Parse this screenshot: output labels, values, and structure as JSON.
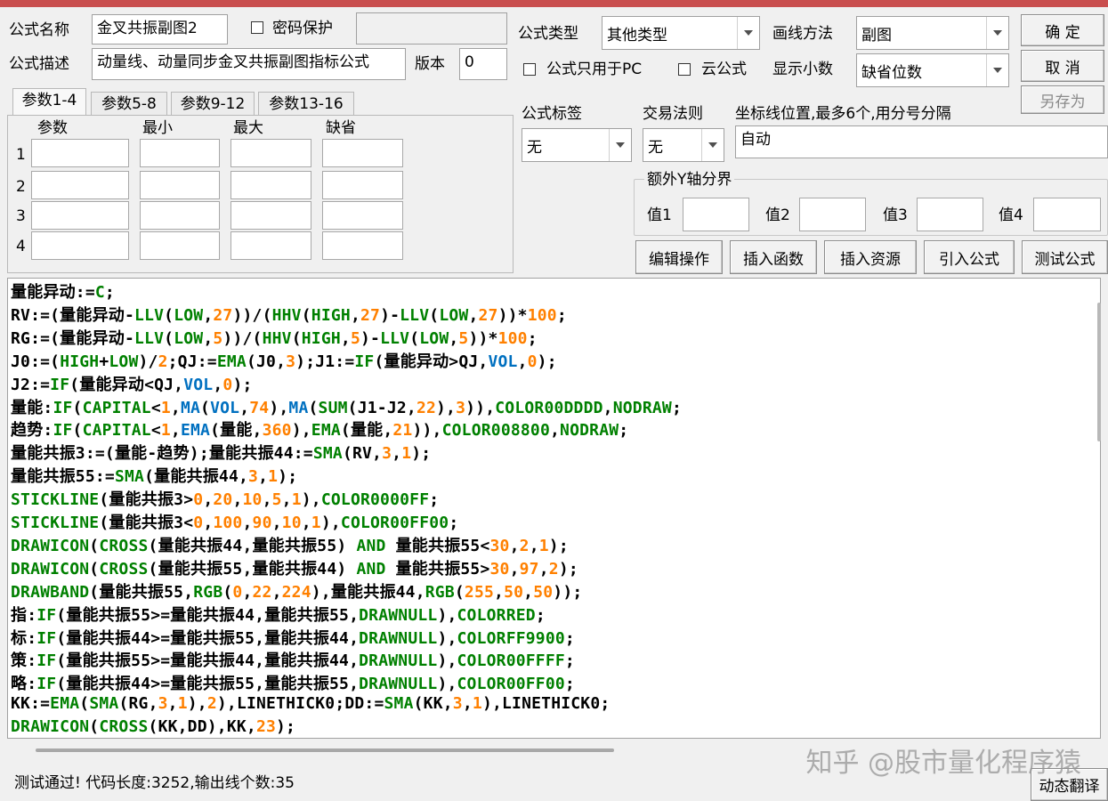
{
  "header": {
    "name_label": "公式名称",
    "name_value": "金叉共振副图2",
    "password_label": "密码保护",
    "password_value": "",
    "desc_label": "公式描述",
    "desc_value": "动量线、动量同步金叉共振副图指标公式",
    "version_label": "版本",
    "version_value": "0",
    "type_label": "公式类型",
    "type_value": "其他类型",
    "draw_label": "画线方法",
    "draw_value": "副图",
    "pc_only_label": "公式只用于PC",
    "cloud_label": "云公式",
    "decimals_label": "显示小数",
    "decimals_value": "缺省位数"
  },
  "buttons": {
    "ok": "确 定",
    "cancel": "取 消",
    "save_as": "另存为",
    "edit_ops": "编辑操作",
    "insert_func": "插入函数",
    "insert_res": "插入资源",
    "import_formula": "引入公式",
    "test_formula": "测试公式",
    "dynamic_translate": "动态翻译"
  },
  "tabs": [
    "参数1-4",
    "参数5-8",
    "参数9-12",
    "参数13-16"
  ],
  "params": {
    "headers": [
      "参数",
      "最小",
      "最大",
      "缺省"
    ],
    "rows": [
      "1",
      "2",
      "3",
      "4"
    ]
  },
  "options": {
    "tag_label": "公式标签",
    "tag_value": "无",
    "trade_label": "交易法则",
    "trade_value": "无",
    "axis_label": "坐标线位置,最多6个,用分号分隔",
    "axis_value": "自动",
    "extra_y_label": "额外Y轴分界",
    "v1": "值1",
    "v2": "值2",
    "v3": "值3",
    "v4": "值4"
  },
  "colors": {
    "keyword": "#008000",
    "number": "#ff8000",
    "series": "#0070c0",
    "plain": "#000000"
  },
  "code_lines": [
    [
      [
        "量能异动:=",
        0
      ],
      [
        "C",
        1
      ],
      [
        ";",
        0
      ]
    ],
    [
      [
        "RV:=(量能异动-",
        0
      ],
      [
        "LLV",
        1
      ],
      [
        "(",
        0
      ],
      [
        "LOW",
        1
      ],
      [
        ",",
        0
      ],
      [
        "27",
        2
      ],
      [
        "))/(",
        0
      ],
      [
        "HHV",
        1
      ],
      [
        "(",
        0
      ],
      [
        "HIGH",
        1
      ],
      [
        ",",
        0
      ],
      [
        "27",
        2
      ],
      [
        ")-",
        0
      ],
      [
        "LLV",
        1
      ],
      [
        "(",
        0
      ],
      [
        "LOW",
        1
      ],
      [
        ",",
        0
      ],
      [
        "27",
        2
      ],
      [
        "))*",
        0
      ],
      [
        "100",
        2
      ],
      [
        ";",
        0
      ]
    ],
    [
      [
        "RG:=(量能异动-",
        0
      ],
      [
        "LLV",
        1
      ],
      [
        "(",
        0
      ],
      [
        "LOW",
        1
      ],
      [
        ",",
        0
      ],
      [
        "5",
        2
      ],
      [
        "))/(",
        0
      ],
      [
        "HHV",
        1
      ],
      [
        "(",
        0
      ],
      [
        "HIGH",
        1
      ],
      [
        ",",
        0
      ],
      [
        "5",
        2
      ],
      [
        ")-",
        0
      ],
      [
        "LLV",
        1
      ],
      [
        "(",
        0
      ],
      [
        "LOW",
        1
      ],
      [
        ",",
        0
      ],
      [
        "5",
        2
      ],
      [
        "))*",
        0
      ],
      [
        "100",
        2
      ],
      [
        ";",
        0
      ]
    ],
    [
      [
        "J0:=(",
        0
      ],
      [
        "HIGH",
        1
      ],
      [
        "+",
        0
      ],
      [
        "LOW",
        1
      ],
      [
        ")/",
        0
      ],
      [
        "2",
        2
      ],
      [
        ";QJ:=",
        0
      ],
      [
        "EMA",
        1
      ],
      [
        "(J0,",
        0
      ],
      [
        "3",
        2
      ],
      [
        ");J1:=",
        0
      ],
      [
        "IF",
        1
      ],
      [
        "(量能异动>QJ,",
        0
      ],
      [
        "VOL",
        3
      ],
      [
        ",",
        0
      ],
      [
        "0",
        2
      ],
      [
        ");",
        0
      ]
    ],
    [
      [
        "J2:=",
        0
      ],
      [
        "IF",
        1
      ],
      [
        "(量能异动<QJ,",
        0
      ],
      [
        "VOL",
        3
      ],
      [
        ",",
        0
      ],
      [
        "0",
        2
      ],
      [
        ");",
        0
      ]
    ],
    [
      [
        "量能:",
        0
      ],
      [
        "IF",
        1
      ],
      [
        "(",
        0
      ],
      [
        "CAPITAL",
        1
      ],
      [
        "<",
        0
      ],
      [
        "1",
        2
      ],
      [
        ",",
        0
      ],
      [
        "MA",
        3
      ],
      [
        "(",
        0
      ],
      [
        "VOL",
        3
      ],
      [
        ",",
        0
      ],
      [
        "74",
        2
      ],
      [
        "),",
        0
      ],
      [
        "MA",
        3
      ],
      [
        "(",
        0
      ],
      [
        "SUM",
        1
      ],
      [
        "(J1-J2,",
        0
      ],
      [
        "22",
        2
      ],
      [
        "),",
        0
      ],
      [
        "3",
        2
      ],
      [
        ")),",
        0
      ],
      [
        "COLOR00DDDD",
        1
      ],
      [
        ",",
        0
      ],
      [
        "NODRAW",
        1
      ],
      [
        ";",
        0
      ]
    ],
    [
      [
        "趋势:",
        0
      ],
      [
        "IF",
        1
      ],
      [
        "(",
        0
      ],
      [
        "CAPITAL",
        1
      ],
      [
        "<",
        0
      ],
      [
        "1",
        2
      ],
      [
        ",",
        0
      ],
      [
        "EMA",
        3
      ],
      [
        "(量能,",
        0
      ],
      [
        "360",
        2
      ],
      [
        "),",
        0
      ],
      [
        "EMA",
        1
      ],
      [
        "(量能,",
        0
      ],
      [
        "21",
        2
      ],
      [
        ")),",
        0
      ],
      [
        "COLOR008800",
        1
      ],
      [
        ",",
        0
      ],
      [
        "NODRAW",
        1
      ],
      [
        ";",
        0
      ]
    ],
    [
      [
        "量能共振3:=(量能-趋势);量能共振44:=",
        0
      ],
      [
        "SMA",
        1
      ],
      [
        "(RV,",
        0
      ],
      [
        "3",
        2
      ],
      [
        ",",
        0
      ],
      [
        "1",
        2
      ],
      [
        ");",
        0
      ]
    ],
    [
      [
        "量能共振55:=",
        0
      ],
      [
        "SMA",
        1
      ],
      [
        "(量能共振44,",
        0
      ],
      [
        "3",
        2
      ],
      [
        ",",
        0
      ],
      [
        "1",
        2
      ],
      [
        ");",
        0
      ]
    ],
    [
      [
        "STICKLINE",
        1
      ],
      [
        "(量能共振3>",
        0
      ],
      [
        "0",
        2
      ],
      [
        ",",
        0
      ],
      [
        "20",
        2
      ],
      [
        ",",
        0
      ],
      [
        "10",
        2
      ],
      [
        ",",
        0
      ],
      [
        "5",
        2
      ],
      [
        ",",
        0
      ],
      [
        "1",
        2
      ],
      [
        "),",
        0
      ],
      [
        "COLOR0000FF",
        1
      ],
      [
        ";",
        0
      ]
    ],
    [
      [
        "STICKLINE",
        1
      ],
      [
        "(量能共振3<",
        0
      ],
      [
        "0",
        2
      ],
      [
        ",",
        0
      ],
      [
        "100",
        2
      ],
      [
        ",",
        0
      ],
      [
        "90",
        2
      ],
      [
        ",",
        0
      ],
      [
        "10",
        2
      ],
      [
        ",",
        0
      ],
      [
        "1",
        2
      ],
      [
        "),",
        0
      ],
      [
        "COLOR00FF00",
        1
      ],
      [
        ";",
        0
      ]
    ],
    [
      [
        "DRAWICON",
        1
      ],
      [
        "(",
        0
      ],
      [
        "CROSS",
        1
      ],
      [
        "(量能共振44,量能共振55) ",
        0
      ],
      [
        "AND",
        1
      ],
      [
        " 量能共振55<",
        0
      ],
      [
        "30",
        2
      ],
      [
        ",",
        0
      ],
      [
        "2",
        2
      ],
      [
        ",",
        0
      ],
      [
        "1",
        2
      ],
      [
        ");",
        0
      ]
    ],
    [
      [
        "DRAWICON",
        1
      ],
      [
        "(",
        0
      ],
      [
        "CROSS",
        1
      ],
      [
        "(量能共振55,量能共振44) ",
        0
      ],
      [
        "AND",
        1
      ],
      [
        " 量能共振55>",
        0
      ],
      [
        "30",
        2
      ],
      [
        ",",
        0
      ],
      [
        "97",
        2
      ],
      [
        ",",
        0
      ],
      [
        "2",
        2
      ],
      [
        ");",
        0
      ]
    ],
    [
      [
        "DRAWBAND",
        1
      ],
      [
        "(量能共振55,",
        0
      ],
      [
        "RGB",
        1
      ],
      [
        "(",
        0
      ],
      [
        "0",
        2
      ],
      [
        ",",
        0
      ],
      [
        "22",
        2
      ],
      [
        ",",
        0
      ],
      [
        "224",
        2
      ],
      [
        "),量能共振44,",
        0
      ],
      [
        "RGB",
        1
      ],
      [
        "(",
        0
      ],
      [
        "255",
        2
      ],
      [
        ",",
        0
      ],
      [
        "50",
        2
      ],
      [
        ",",
        0
      ],
      [
        "50",
        2
      ],
      [
        "));",
        0
      ]
    ],
    [
      [
        "指:",
        0
      ],
      [
        "IF",
        1
      ],
      [
        "(量能共振55>=量能共振44,量能共振55,",
        0
      ],
      [
        "DRAWNULL",
        1
      ],
      [
        "),",
        0
      ],
      [
        "COLORRED",
        1
      ],
      [
        ";",
        0
      ]
    ],
    [
      [
        "标:",
        0
      ],
      [
        "IF",
        1
      ],
      [
        "(量能共振44>=量能共振55,量能共振44,",
        0
      ],
      [
        "DRAWNULL",
        1
      ],
      [
        "),",
        0
      ],
      [
        "COLORFF9900",
        1
      ],
      [
        ";",
        0
      ]
    ],
    [
      [
        "策:",
        0
      ],
      [
        "IF",
        1
      ],
      [
        "(量能共振55>=量能共振44,量能共振44,",
        0
      ],
      [
        "DRAWNULL",
        1
      ],
      [
        "),",
        0
      ],
      [
        "COLOR00FFFF",
        1
      ],
      [
        ";",
        0
      ]
    ],
    [
      [
        "略:",
        0
      ],
      [
        "IF",
        1
      ],
      [
        "(量能共振44>=量能共振55,量能共振55,",
        0
      ],
      [
        "DRAWNULL",
        1
      ],
      [
        "),",
        0
      ],
      [
        "COLOR00FF00",
        1
      ],
      [
        ";",
        0
      ]
    ],
    [
      [
        "KK:=",
        0
      ],
      [
        "EMA",
        1
      ],
      [
        "(",
        0
      ],
      [
        "SMA",
        1
      ],
      [
        "(RG,",
        0
      ],
      [
        "3",
        2
      ],
      [
        ",",
        0
      ],
      [
        "1",
        2
      ],
      [
        "),",
        0
      ],
      [
        "2",
        2
      ],
      [
        "),LINETHICK0;DD:=",
        0
      ],
      [
        "SMA",
        1
      ],
      [
        "(KK,",
        0
      ],
      [
        "3",
        2
      ],
      [
        ",",
        0
      ],
      [
        "1",
        2
      ],
      [
        "),LINETHICK0;",
        0
      ]
    ],
    [
      [
        "DRAWICON",
        1
      ],
      [
        "(",
        0
      ],
      [
        "CROSS",
        1
      ],
      [
        "(KK,DD),KK,",
        0
      ],
      [
        "23",
        2
      ],
      [
        ");",
        0
      ]
    ]
  ],
  "status_text": "测试通过! 代码长度:3252,输出线个数:35",
  "watermark": "知乎 @股市量化程序猿"
}
